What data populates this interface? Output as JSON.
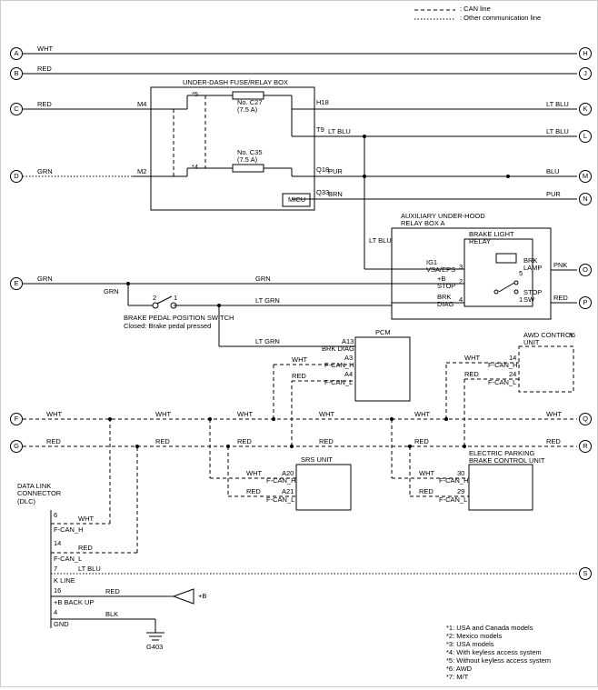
{
  "legend": {
    "can_line": ": CAN line",
    "other_line": ": Other communication line"
  },
  "bubbles": {
    "A": "A",
    "B": "B",
    "C": "C",
    "D": "D",
    "E": "E",
    "F": "F",
    "G": "G",
    "H": "H",
    "J": "J",
    "K": "K",
    "L": "L",
    "M": "M",
    "N": "N",
    "O": "O",
    "P": "P",
    "Q": "Q",
    "R": "R",
    "S": "S"
  },
  "colors": {
    "WHT": "WHT",
    "RED": "RED",
    "GRN": "GRN",
    "LT_BLU": "LT BLU",
    "BLU": "BLU",
    "PUR": "PUR",
    "BRN": "BRN",
    "PNK": "PNK",
    "LT_GRN": "LT GRN",
    "BLK": "BLK"
  },
  "fuse_relay_box": {
    "title": "UNDER-DASH FUSE/RELAY BOX",
    "note5": "*5",
    "note4": "*4",
    "pins": {
      "M4": "M4",
      "H18": "H18",
      "T9": "T9",
      "M2": "M2",
      "Q18": "Q18",
      "Q33": "Q33"
    },
    "fuse1": "No. C27\n(7.5 A)",
    "fuse2": "No. C35\n(7.5 A)",
    "micu": "MICU"
  },
  "aux_relay_box": {
    "title": "AUXILIARY UNDER-HOOD\nRELAY BOX A",
    "relay": "BRAKE LIGHT\nRELAY",
    "labels": {
      "ig1": "IG1\nVSA/EPS",
      "plusB": "+B\nSTOP",
      "brk_diag": "BRK\nDIAG",
      "brk_lamp": "BRK\nLAMP",
      "stop_sw": "STOP\nSW",
      "p3": "3",
      "p5": "5",
      "p2": "2",
      "p4": "4",
      "p1": "1"
    }
  },
  "brake_switch": {
    "title": "BRAKE PEDAL POSITION SWITCH",
    "subtitle": "Closed: Brake pedal pressed",
    "pins": {
      "p2": "2",
      "p1": "1"
    }
  },
  "pcm": {
    "title": "PCM",
    "pins": {
      "A13": "A13",
      "BRK_DIAG": "BRK DIAG",
      "A3": "A3",
      "A4": "A4",
      "FCANH": "F-CAN_H",
      "FCANL": "F-CAN_L"
    }
  },
  "awd": {
    "title": "AWD CONTROL\nUNIT",
    "note6": "*6",
    "pins": {
      "p14": "14",
      "p24": "24",
      "FCANH": "F-CAN_H",
      "FCANL": "F-CAN_L"
    }
  },
  "srs": {
    "title": "SRS UNIT",
    "pins": {
      "A20": "A20",
      "A21": "A21",
      "FCANH": "F-CAN_H",
      "FCANL": "F-CAN_L"
    }
  },
  "epb": {
    "title": "ELECTRIC PARKING\nBRAKE CONTROL UNIT",
    "pins": {
      "p30": "30",
      "p29": "29",
      "FCANH": "F-CAN_H",
      "FCANL": "F-CAN_L"
    }
  },
  "dlc": {
    "title": "DATA LINK\nCONNECTOR\n(DLC)",
    "pins": {
      "p6": "6",
      "FCANH": "F-CAN_H",
      "p14": "14",
      "FCANL": "F-CAN_L",
      "p7": "7",
      "KLINE": "K LINE",
      "p16": "16",
      "BBACKUP": "+B BACK UP",
      "p4": "4",
      "GND": "GND"
    },
    "plusB": "+B",
    "G403": "G403"
  },
  "notes": {
    "n1": "*1: USA and Canada models",
    "n2": "*2: Mexico models",
    "n3": "*3: USA models",
    "n4": "*4: With keyless access system",
    "n5": "*5: Without keyless access system",
    "n6": "*6: AWD",
    "n7": "*7: M/T"
  }
}
